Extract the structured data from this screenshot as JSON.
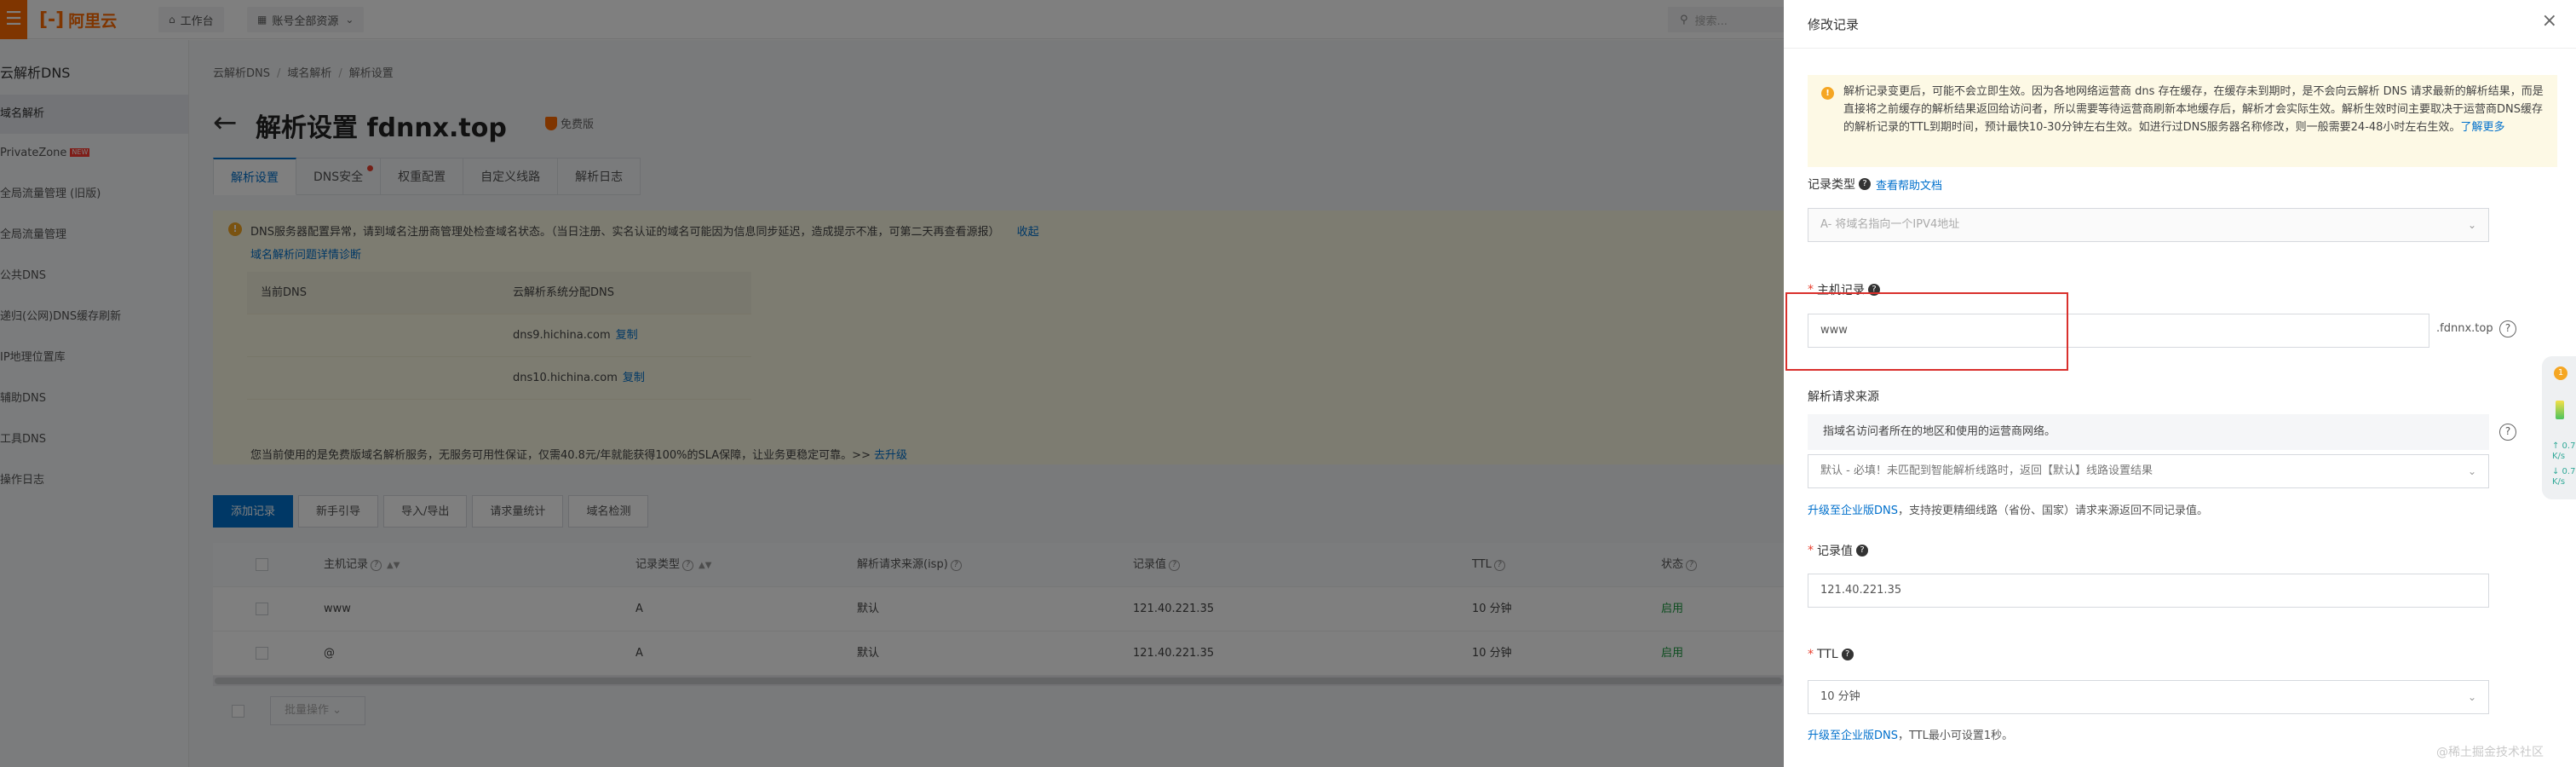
{
  "topbar": {
    "menu_icon": "menu-icon",
    "logo_text": "阿里云",
    "workbench_label": "工作台",
    "resources_label": "账号全部资源",
    "search_placeholder": "搜索..."
  },
  "sidebar": {
    "title": "云解析DNS",
    "items": [
      {
        "label": "域名解析",
        "active": true
      },
      {
        "label": "PrivateZone",
        "new": true
      },
      {
        "label": "全局流量管理（旧版）"
      },
      {
        "label": "全局流量管理"
      },
      {
        "label": "公共DNS"
      },
      {
        "label": "递归(公网)DNS缓存刷新"
      },
      {
        "label": "IP地理位置库"
      },
      {
        "label": "辅助DNS"
      },
      {
        "label": "工具DNS"
      },
      {
        "label": "操作日志"
      }
    ],
    "visible_labels": [
      "云解析DNS",
      "域名解析",
      "PrivateZone",
      "全局流量管理 (旧版)",
      "全局流量管理",
      "公共DNS",
      "递归(公网)DNS缓存刷新",
      "IP地理位置库",
      "辅助DNS",
      "工具DNS",
      "操作日志"
    ]
  },
  "main": {
    "breadcrumb": [
      "云解析DNS",
      "域名解析",
      "解析设置"
    ],
    "title": "解析设置 fdnnx.top",
    "plan": "免费版",
    "tabs": [
      "解析设置",
      "DNS安全",
      "权重配置",
      "自定义线路",
      "解析日志"
    ],
    "alert": {
      "text": "DNS服务器配置异常，请到域名注册商管理处检查域名状态。（当日注册、实名认证的域名可能因为信息同步延迟，造成提示不准，可第二天再查看源报）",
      "collapse": "收起",
      "diag_link": "域名解析问题详情诊断",
      "table_headers": [
        "当前DNS",
        "云解析系统分配DNS"
      ],
      "rows": [
        {
          "current": "",
          "assigned": "dns9.hichina.com",
          "copy": "复制"
        },
        {
          "current": "",
          "assigned": "dns10.hichina.com",
          "copy": "复制"
        }
      ],
      "footer": "您当前使用的是免费版域名解析服务，无服务可用性保证，仅需40.8元/年就能获得100%的SLA保障，让业务更稳定可靠。>>",
      "upgrade": "去升级"
    },
    "buttons": [
      "添加记录",
      "新手引导",
      "导入/导出",
      "请求量统计",
      "域名检测"
    ],
    "table": {
      "headers": [
        "主机记录",
        "记录类型",
        "解析请求来源(isp)",
        "记录值",
        "TTL",
        "状态"
      ],
      "rows": [
        {
          "host": "www",
          "type": "A",
          "source": "默认",
          "value": "121.40.221.35",
          "ttl": "10 分钟",
          "status": "启用"
        },
        {
          "host": "@",
          "type": "A",
          "source": "默认",
          "value": "121.40.221.35",
          "ttl": "10 分钟",
          "status": "启用"
        }
      ]
    },
    "bulk_label": "批量操作"
  },
  "drawer": {
    "title": "修改记录",
    "notice": "解析记录变更后，可能不会立即生效。因为各地网络运营商 dns 存在缓存，在缓存未到期时，是不会向云解析 DNS 请求最新的解析结果，而是直接将之前缓存的解析结果返回给访问者，所以需要等待运营商刷新本地缓存后，解析才会实际生效。解析生效时间主要取决于运营商DNS缓存的解析记录的TTL到期时间，预计最快10-30分钟左右生效。如进行过DNS服务器名称修改，则一般需要24-48小时左右生效。",
    "notice_link": "了解更多",
    "record_type_label": "记录类型",
    "help_doc": "查看帮助文档",
    "record_type_value": "A- 将域名指向一个IPV4地址",
    "host_label": "主机记录",
    "host_value": "www",
    "host_suffix": ".fdnnx.top",
    "source_label": "解析请求来源",
    "source_info": "指域名访问者所在的地区和使用的运营商网络。",
    "source_value": "默认 - 必填！未匹配到智能解析线路时，返回【默认】线路设置结果",
    "source_hint_link": "升级至企业版DNS",
    "source_hint": "，支持按更精细线路（省份、国家）请求来源返回不同记录值。",
    "value_label": "记录值",
    "value_value": "121.40.221.35",
    "ttl_label": "TTL",
    "ttl_value": "10 分钟",
    "ttl_hint_link": "升级至企业版DNS",
    "ttl_hint": "，TTL最小可设置1秒。",
    "watermark": "@稀土掘金技术社区"
  },
  "widget": {
    "badge": "1",
    "stat1": "↑ 0.7 K/s",
    "stat2": "↓ 0.7 K/s"
  },
  "colors": {
    "brand": "#ff6a00",
    "primary": "#0070cc",
    "danger": "#d9302c",
    "success": "#1a9a3f"
  }
}
